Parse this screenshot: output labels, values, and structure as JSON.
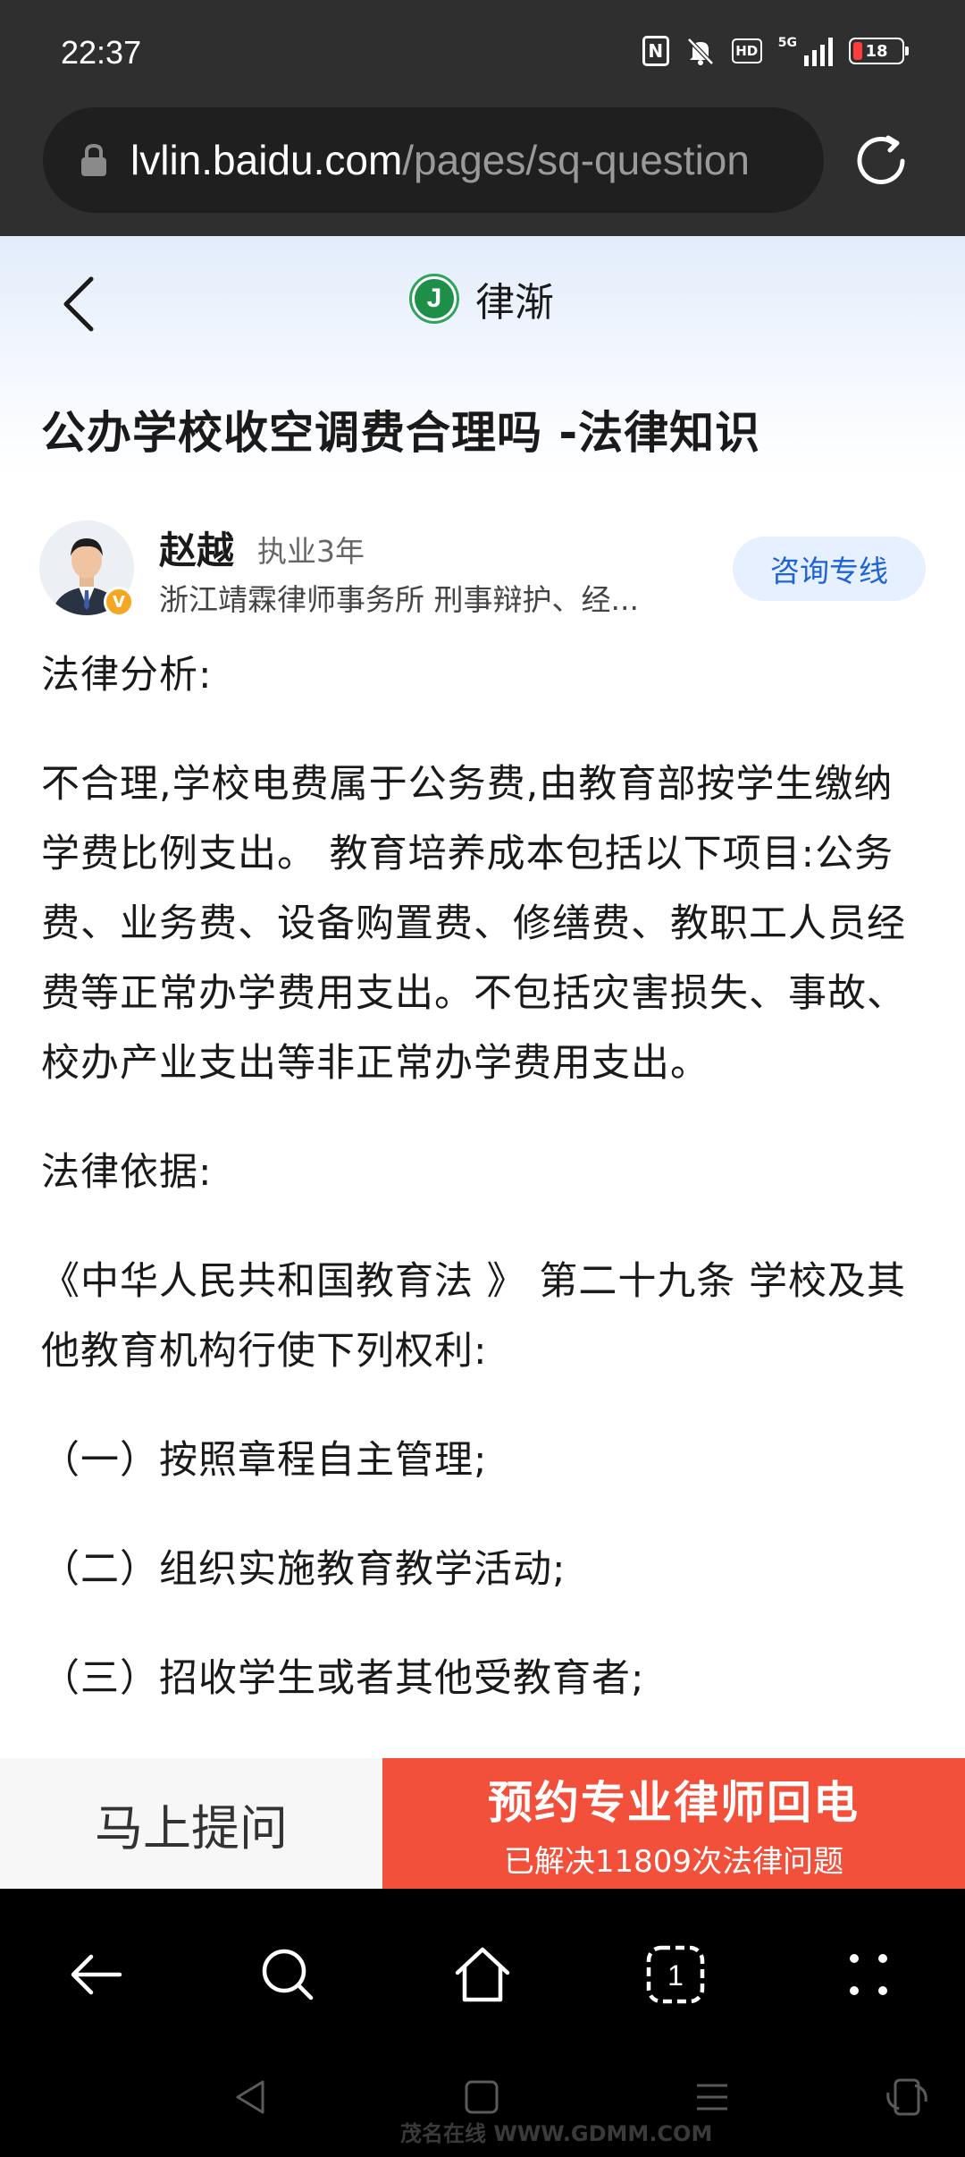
{
  "status_bar": {
    "time": "22:37",
    "network": "5G",
    "battery": "18",
    "icons": [
      "nfc-icon",
      "mute-icon",
      "hd-icon",
      "signal-icon",
      "battery-icon"
    ]
  },
  "browser": {
    "url_host": "lvlin.baidu.com",
    "url_path": "/pages/sq-question"
  },
  "header": {
    "brand_logo_letter": "J",
    "brand_name": "律渐",
    "title": "公办学校收空调费合理吗 -法律知识"
  },
  "lawyer": {
    "name": "赵越",
    "years": "执业3年",
    "firm": "浙江靖霖律师事务所  刑事辩护、经...",
    "verify_badge": "V",
    "consult_label": "咨询专线"
  },
  "article": {
    "analysis_heading": "法律分析:",
    "analysis_body": "不合理,学校电费属于公务费,由教育部按学生缴纳学费比例支出。 教育培养成本包括以下项目:公务费、业务费、设备购置费、修缮费、教职工人员经费等正常办学费用支出。不包括灾害损失、事故、校办产业支出等非正常办学费用支出。",
    "basis_heading": "法律依据:",
    "basis_body": "《中华人民共和国教育法 》 第二十九条 学校及其他教育机构行使下列权利:",
    "item1": "（一）按照章程自主管理;",
    "item2": "（二）组织实施教育教学活动;",
    "item3": "（三）招收学生或者其他受教育者;"
  },
  "cta": {
    "ask_label": "马上提问",
    "book_label": "预约专业律师回电",
    "book_sub": "已解决11809次法律问题"
  },
  "watermark": "茂名在线 WWW.GDMM.COM"
}
